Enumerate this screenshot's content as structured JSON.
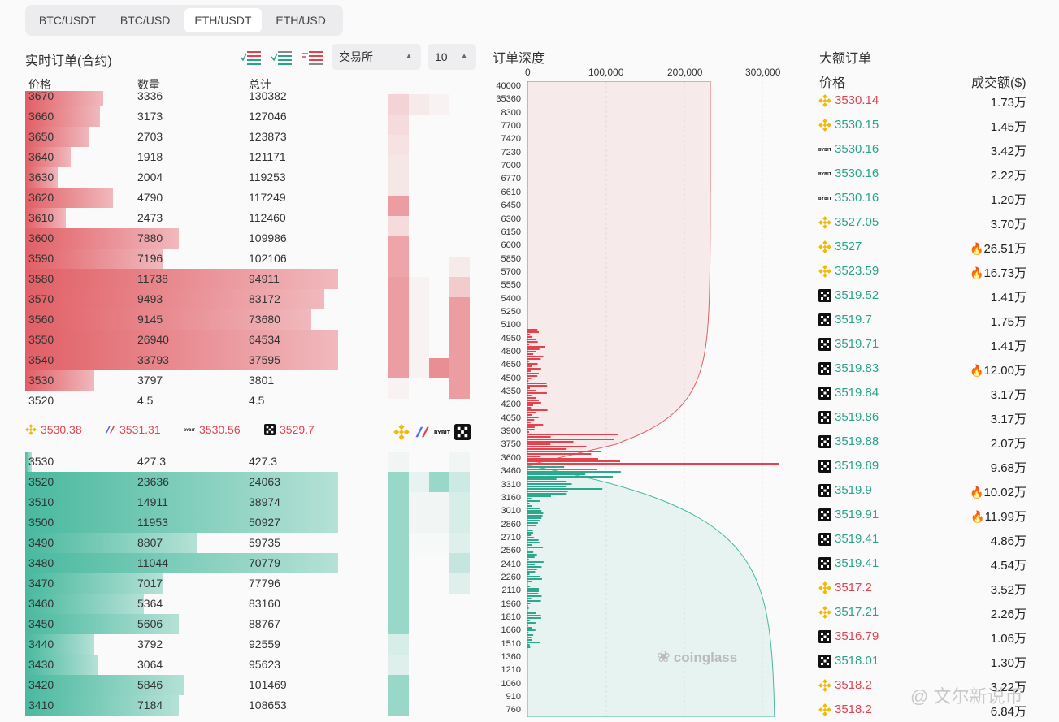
{
  "tabs": [
    "BTC/USDT",
    "BTC/USD",
    "ETH/USDT",
    "ETH/USD"
  ],
  "active_tab": 2,
  "orderbook": {
    "title": "实时订单(合约)",
    "exchange_select": "交易所",
    "depth_select": "10",
    "col_price": "价格",
    "col_qty": "数量",
    "col_total": "总计",
    "asks": [
      {
        "p": "3670",
        "q": "3336",
        "t": "130382",
        "w": 0.25
      },
      {
        "p": "3660",
        "q": "3173",
        "t": "127046",
        "w": 0.24
      },
      {
        "p": "3650",
        "q": "2703",
        "t": "123873",
        "w": 0.205
      },
      {
        "p": "3640",
        "q": "1918",
        "t": "121171",
        "w": 0.145
      },
      {
        "p": "3630",
        "q": "2004",
        "t": "119253",
        "w": 0.105
      },
      {
        "p": "3620",
        "q": "4790",
        "t": "117249",
        "w": 0.28
      },
      {
        "p": "3610",
        "q": "2473",
        "t": "112460",
        "w": 0.13
      },
      {
        "p": "3600",
        "q": "7880",
        "t": "109986",
        "w": 0.49
      },
      {
        "p": "3590",
        "q": "7196",
        "t": "102106",
        "w": 0.44
      },
      {
        "p": "3580",
        "q": "11738",
        "t": "94911",
        "w": 1.0
      },
      {
        "p": "3570",
        "q": "9493",
        "t": "83172",
        "w": 0.955
      },
      {
        "p": "3560",
        "q": "9145",
        "t": "73680",
        "w": 0.915
      },
      {
        "p": "3550",
        "q": "26940",
        "t": "64534",
        "w": 1.0
      },
      {
        "p": "3540",
        "q": "33793",
        "t": "37595",
        "w": 1.0
      },
      {
        "p": "3530",
        "q": "3797",
        "t": "3801",
        "w": 0.22
      },
      {
        "p": "3520",
        "q": "4.5",
        "t": "4.5",
        "w": 0
      }
    ],
    "bids": [
      {
        "p": "3530",
        "q": "427.3",
        "t": "427.3",
        "w": 0.02
      },
      {
        "p": "3520",
        "q": "23636",
        "t": "24063",
        "w": 1.0
      },
      {
        "p": "3510",
        "q": "14911",
        "t": "38974",
        "w": 1.0
      },
      {
        "p": "3500",
        "q": "11953",
        "t": "50927",
        "w": 1.0
      },
      {
        "p": "3490",
        "q": "8807",
        "t": "59735",
        "w": 0.55
      },
      {
        "p": "3480",
        "q": "11044",
        "t": "70779",
        "w": 1.0
      },
      {
        "p": "3470",
        "q": "7017",
        "t": "77796",
        "w": 0.44
      },
      {
        "p": "3460",
        "q": "5364",
        "t": "83160",
        "w": 0.38
      },
      {
        "p": "3450",
        "q": "5606",
        "t": "88767",
        "w": 0.49
      },
      {
        "p": "3440",
        "q": "3792",
        "t": "92559",
        "w": 0.22
      },
      {
        "p": "3430",
        "q": "3064",
        "t": "95623",
        "w": 0.235
      },
      {
        "p": "3420",
        "q": "5846",
        "t": "101469",
        "w": 0.51
      },
      {
        "p": "3410",
        "q": "7184",
        "t": "108653",
        "w": 0.49
      }
    ],
    "mid_prices": [
      {
        "icon": "binance",
        "price": "3530.38"
      },
      {
        "icon": "bitmex",
        "price": "3531.31"
      },
      {
        "icon": "bybit",
        "price": "3530.56"
      },
      {
        "icon": "okx",
        "price": "3529.7"
      }
    ]
  },
  "depth": {
    "title": "订单深度",
    "x_ticks": [
      "0",
      "100,000",
      "200,000",
      "300,000"
    ],
    "y_labels": [
      "40000",
      "35360",
      "8300",
      "7700",
      "7420",
      "7230",
      "7000",
      "6770",
      "6610",
      "6450",
      "6300",
      "6150",
      "6000",
      "5850",
      "5700",
      "5550",
      "5400",
      "5250",
      "5100",
      "4950",
      "4800",
      "4650",
      "4500",
      "4350",
      "4200",
      "4050",
      "3900",
      "3750",
      "3600",
      "3460",
      "3310",
      "3160",
      "3010",
      "2860",
      "2710",
      "2560",
      "2410",
      "2260",
      "2110",
      "1960",
      "1810",
      "1660",
      "1510",
      "1360",
      "1210",
      "1060",
      "910",
      "760"
    ],
    "watermark": "coinglass"
  },
  "big_orders": {
    "title": "大额订单",
    "col_price": "价格",
    "col_amount": "成交额($)",
    "rows": [
      {
        "icon": "binance",
        "price": "3530.14",
        "side": "red",
        "amount": "1.73万",
        "fire": false
      },
      {
        "icon": "binance",
        "price": "3530.15",
        "side": "green",
        "amount": "1.45万",
        "fire": false
      },
      {
        "icon": "bybit",
        "price": "3530.16",
        "side": "green",
        "amount": "3.42万",
        "fire": false
      },
      {
        "icon": "bybit",
        "price": "3530.16",
        "side": "green",
        "amount": "2.22万",
        "fire": false
      },
      {
        "icon": "bybit",
        "price": "3530.16",
        "side": "green",
        "amount": "1.20万",
        "fire": false
      },
      {
        "icon": "binance",
        "price": "3527.05",
        "side": "green",
        "amount": "3.70万",
        "fire": false
      },
      {
        "icon": "binance",
        "price": "3527",
        "side": "green",
        "amount": "26.51万",
        "fire": true
      },
      {
        "icon": "binance",
        "price": "3523.59",
        "side": "green",
        "amount": "16.73万",
        "fire": true
      },
      {
        "icon": "okx",
        "price": "3519.52",
        "side": "green",
        "amount": "1.41万",
        "fire": false
      },
      {
        "icon": "okx",
        "price": "3519.7",
        "side": "green",
        "amount": "1.75万",
        "fire": false
      },
      {
        "icon": "okx",
        "price": "3519.71",
        "side": "green",
        "amount": "1.41万",
        "fire": false
      },
      {
        "icon": "okx",
        "price": "3519.83",
        "side": "green",
        "amount": "12.00万",
        "fire": true
      },
      {
        "icon": "okx",
        "price": "3519.84",
        "side": "green",
        "amount": "3.17万",
        "fire": false
      },
      {
        "icon": "okx",
        "price": "3519.86",
        "side": "green",
        "amount": "3.17万",
        "fire": false
      },
      {
        "icon": "okx",
        "price": "3519.88",
        "side": "green",
        "amount": "2.07万",
        "fire": false
      },
      {
        "icon": "okx",
        "price": "3519.89",
        "side": "green",
        "amount": "9.68万",
        "fire": false
      },
      {
        "icon": "okx",
        "price": "3519.9",
        "side": "green",
        "amount": "10.02万",
        "fire": true
      },
      {
        "icon": "okx",
        "price": "3519.91",
        "side": "green",
        "amount": "11.99万",
        "fire": true
      },
      {
        "icon": "okx",
        "price": "3519.41",
        "side": "green",
        "amount": "4.86万",
        "fire": false
      },
      {
        "icon": "okx",
        "price": "3519.41",
        "side": "green",
        "amount": "4.54万",
        "fire": false
      },
      {
        "icon": "binance",
        "price": "3517.2",
        "side": "red",
        "amount": "3.52万",
        "fire": false
      },
      {
        "icon": "binance",
        "price": "3517.21",
        "side": "green",
        "amount": "2.26万",
        "fire": false
      },
      {
        "icon": "okx",
        "price": "3516.79",
        "side": "red",
        "amount": "1.06万",
        "fire": false
      },
      {
        "icon": "okx",
        "price": "3518.01",
        "side": "green",
        "amount": "1.30万",
        "fire": false
      },
      {
        "icon": "binance",
        "price": "3518.2",
        "side": "red",
        "amount": "3.22万",
        "fire": false
      },
      {
        "icon": "binance",
        "price": "3518.2",
        "side": "red",
        "amount": "6.84万",
        "fire": false
      }
    ]
  },
  "corner_watermark": "@ 文尔新说币",
  "colors": {
    "ask": "#e15f66",
    "bid": "#49b99f",
    "price_red": "#e0434f",
    "price_green": "#2aa38c"
  }
}
